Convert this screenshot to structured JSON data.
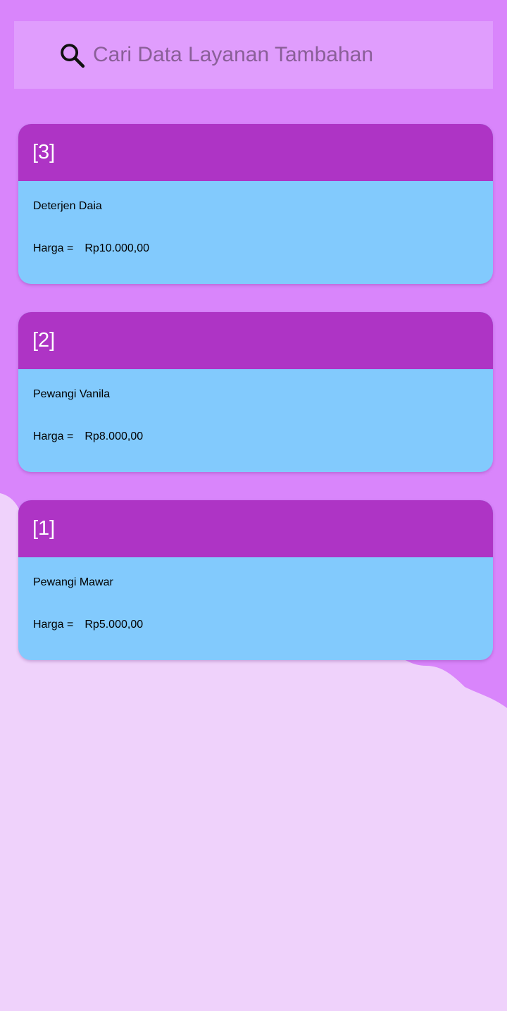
{
  "search": {
    "placeholder": "Cari Data Layanan Tambahan",
    "value": "",
    "icon": "search-icon"
  },
  "colors": {
    "background": "#d985fb",
    "background_wave": "#efd2fb",
    "search_bar": "#e09dfd",
    "card_header": "#ae34c5",
    "card_body": "#82cafd"
  },
  "items": [
    {
      "id": "[3]",
      "name": "Deterjen Daia",
      "price_label": "Harga =",
      "price": "Rp10.000,00"
    },
    {
      "id": "[2]",
      "name": "Pewangi Vanila",
      "price_label": "Harga =",
      "price": "Rp8.000,00"
    },
    {
      "id": "[1]",
      "name": "Pewangi Mawar",
      "price_label": "Harga =",
      "price": "Rp5.000,00"
    }
  ]
}
